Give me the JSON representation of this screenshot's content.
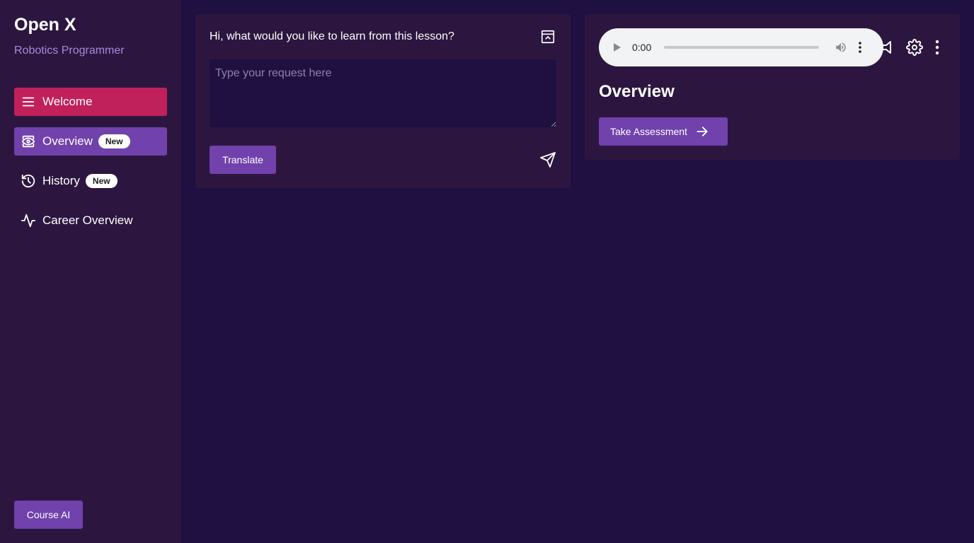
{
  "app": {
    "title": "Open X",
    "subtitle": "Robotics Programmer"
  },
  "sidebar": {
    "items": [
      {
        "label": "Welcome",
        "icon": "menu-icon",
        "badge": null,
        "state": "active-red"
      },
      {
        "label": "Overview",
        "icon": "eye-icon",
        "badge": "New",
        "state": "active-purple"
      },
      {
        "label": "History",
        "icon": "history-icon",
        "badge": "New",
        "state": "default"
      },
      {
        "label": "Career Overview",
        "icon": "activity-icon",
        "badge": null,
        "state": "default"
      }
    ],
    "course_ai_label": "Course AI"
  },
  "chat": {
    "prompt": "Hi, what would you like to learn from this lesson?",
    "input_placeholder": "Type your request here",
    "input_value": "",
    "translate_label": "Translate"
  },
  "overview": {
    "audio": {
      "time": "0:00",
      "progress": 0
    },
    "title": "Overview",
    "assessment_label": "Take Assessment"
  },
  "colors": {
    "background": "#200f41",
    "panel": "#2c163f",
    "accent_purple": "#7141ac",
    "accent_red": "#c0215b",
    "subtitle": "#a48bdc"
  }
}
